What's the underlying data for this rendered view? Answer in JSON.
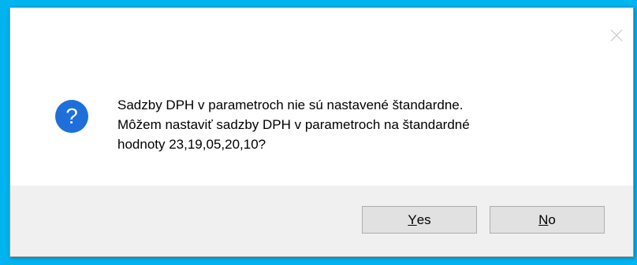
{
  "dialog": {
    "message_lines": [
      "Sadzby DPH v parametroch nie sú nastavené štandardne.",
      "Môžem nastaviť sadzby DPH v parametroch na štandardné",
      "hodnoty 23,19,05,20,10?"
    ],
    "icon": "question-icon",
    "close_icon": "close-icon"
  },
  "buttons": {
    "yes": {
      "mnemonic": "Y",
      "rest": "es"
    },
    "no": {
      "mnemonic": "N",
      "rest": "o"
    }
  },
  "colors": {
    "background": "#00b4f0",
    "icon_fill": "#1e6fd9",
    "footer": "#f0f0f0",
    "button_face": "#e1e1e1",
    "button_border": "#adadad"
  }
}
